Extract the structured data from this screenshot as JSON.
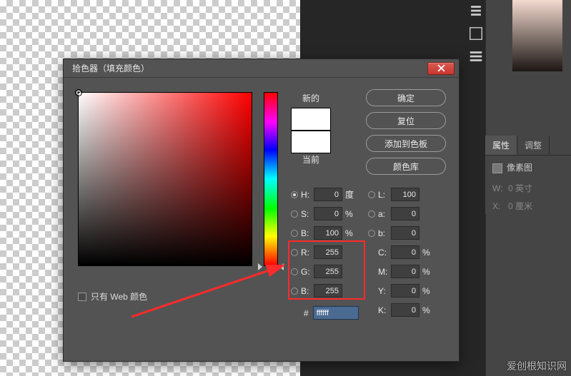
{
  "dialog": {
    "title": "拾色器（填充颜色）",
    "new_label": "新的",
    "current_label": "当前",
    "actions": {
      "ok": "确定",
      "reset": "复位",
      "add_swatch": "添加到色板",
      "libraries": "颜色库"
    },
    "fields": {
      "H": {
        "label": "H:",
        "value": "0",
        "unit": "度"
      },
      "S": {
        "label": "S:",
        "value": "0",
        "unit": "%"
      },
      "Bv": {
        "label": "B:",
        "value": "100",
        "unit": "%"
      },
      "R": {
        "label": "R:",
        "value": "255"
      },
      "G": {
        "label": "G:",
        "value": "255"
      },
      "Bb": {
        "label": "B:",
        "value": "255"
      },
      "L": {
        "label": "L:",
        "value": "100"
      },
      "a": {
        "label": "a:",
        "value": "0"
      },
      "b": {
        "label": "b:",
        "value": "0"
      },
      "C": {
        "label": "C:",
        "value": "0",
        "unit": "%"
      },
      "M": {
        "label": "M:",
        "value": "0",
        "unit": "%"
      },
      "Y": {
        "label": "Y:",
        "value": "0",
        "unit": "%"
      },
      "K": {
        "label": "K:",
        "value": "0",
        "unit": "%"
      }
    },
    "hex": {
      "label": "#",
      "value": "ffffff"
    },
    "web_only": "只有 Web 颜色"
  },
  "right_panel": {
    "tab_props": "属性",
    "tab_adjust": "调整",
    "layer_type": "像素图",
    "width": {
      "label": "W:",
      "value": "0 英寸"
    },
    "height": {
      "label": "X:",
      "value": "0 厘米"
    }
  },
  "watermark": "爱创根知识网"
}
